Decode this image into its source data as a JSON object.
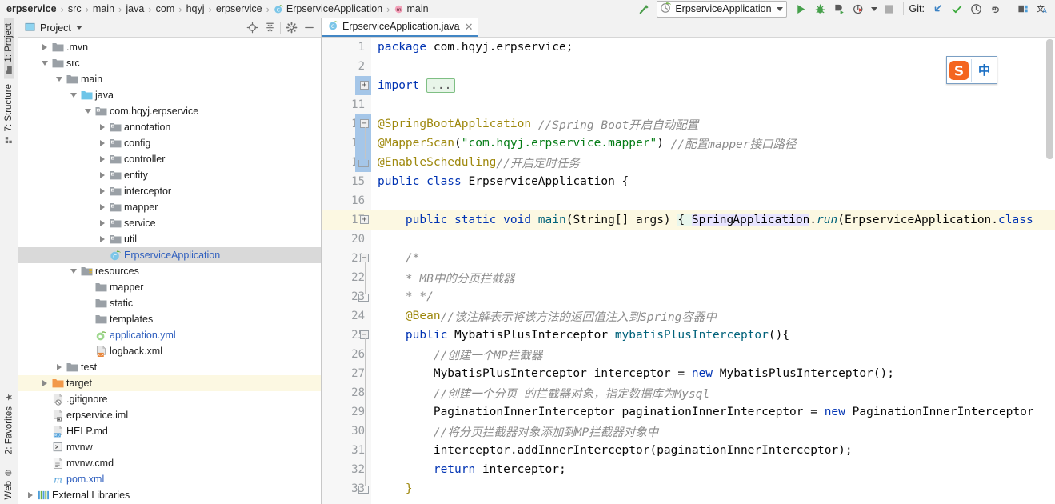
{
  "breadcrumb": {
    "items": [
      {
        "label": "erpservice",
        "icon": "",
        "bold": true
      },
      {
        "label": "src",
        "icon": "",
        "bold": false
      },
      {
        "label": "main",
        "icon": "",
        "bold": false
      },
      {
        "label": "java",
        "icon": "",
        "bold": false
      },
      {
        "label": "com",
        "icon": "",
        "bold": false
      },
      {
        "label": "hqyj",
        "icon": "",
        "bold": false
      },
      {
        "label": "erpservice",
        "icon": "",
        "bold": false
      },
      {
        "label": "ErpserviceApplication",
        "icon": "java-class-icon",
        "bold": false
      },
      {
        "label": "main",
        "icon": "method-icon",
        "bold": false
      }
    ],
    "separator": "›"
  },
  "toolbar": {
    "build_icon": "hammer-icon",
    "run_config": {
      "name": "ErpserviceApplication",
      "icon": "spring-boot-icon",
      "dropdown_icon": "chevron-down-icon"
    },
    "run_icon": "run-icon",
    "debug_icon": "debug-icon",
    "run_coverage_icon": "run-with-coverage-icon",
    "profile_icon": "profiler-icon",
    "profile_dropdown_icon": "chevron-down-icon",
    "stop_icon": "stop-icon",
    "git_label": "Git:",
    "git_update_icon": "update-project-icon",
    "git_commit_icon": "commit-icon",
    "git_history_icon": "history-icon",
    "git_rollback_icon": "rollback-icon",
    "search_everywhere_icon": "search-everywhere-icon",
    "translate_icon": "translate-icon",
    "colors": {
      "run_green": "#46a04b",
      "git_blue": "#3b82c4",
      "check_green": "#3eaa3e"
    }
  },
  "left_rail": {
    "top": [
      {
        "label": "1: Project",
        "icon": "project-icon",
        "active": true
      },
      {
        "label": "7: Structure",
        "icon": "structure-icon",
        "active": false
      }
    ],
    "bottom": [
      {
        "label": "2: Favorites",
        "icon": "star-icon",
        "active": false
      },
      {
        "label": "Web",
        "icon": "web-icon",
        "active": false
      }
    ]
  },
  "project_panel": {
    "title": "Project",
    "title_icon": "project-view-icon",
    "dropdown_icon": "chevron-down-icon",
    "actions": [
      {
        "name": "locate-icon",
        "label": ""
      },
      {
        "name": "collapse-all-icon",
        "label": ""
      },
      {
        "name": "settings-gear-icon",
        "label": ""
      },
      {
        "name": "hide-icon",
        "label": ""
      }
    ],
    "tree": [
      {
        "label": ".mvn",
        "indent": 1,
        "twisty": "right",
        "icon": "folder-icon",
        "state": "normal"
      },
      {
        "label": "src",
        "indent": 1,
        "twisty": "down",
        "icon": "folder-icon",
        "state": "normal"
      },
      {
        "label": "main",
        "indent": 2,
        "twisty": "down",
        "icon": "folder-icon",
        "state": "normal"
      },
      {
        "label": "java",
        "indent": 3,
        "twisty": "down",
        "icon": "source-folder-icon",
        "state": "normal"
      },
      {
        "label": "com.hqyj.erpservice",
        "indent": 4,
        "twisty": "down",
        "icon": "package-icon",
        "state": "normal"
      },
      {
        "label": "annotation",
        "indent": 5,
        "twisty": "right",
        "icon": "package-icon",
        "state": "normal"
      },
      {
        "label": "config",
        "indent": 5,
        "twisty": "right",
        "icon": "package-icon",
        "state": "normal"
      },
      {
        "label": "controller",
        "indent": 5,
        "twisty": "right",
        "icon": "package-icon",
        "state": "normal"
      },
      {
        "label": "entity",
        "indent": 5,
        "twisty": "right",
        "icon": "package-icon",
        "state": "normal"
      },
      {
        "label": "interceptor",
        "indent": 5,
        "twisty": "right",
        "icon": "package-icon",
        "state": "normal"
      },
      {
        "label": "mapper",
        "indent": 5,
        "twisty": "right",
        "icon": "package-icon",
        "state": "normal"
      },
      {
        "label": "service",
        "indent": 5,
        "twisty": "right",
        "icon": "package-icon",
        "state": "normal"
      },
      {
        "label": "util",
        "indent": 5,
        "twisty": "right",
        "icon": "package-icon",
        "state": "normal"
      },
      {
        "label": "ErpserviceApplication",
        "indent": 5,
        "twisty": "none",
        "icon": "spring-class-icon",
        "state": "selected"
      },
      {
        "label": "resources",
        "indent": 3,
        "twisty": "down",
        "icon": "resource-folder-icon",
        "state": "normal"
      },
      {
        "label": "mapper",
        "indent": 4,
        "twisty": "none",
        "icon": "folder-icon",
        "state": "normal"
      },
      {
        "label": "static",
        "indent": 4,
        "twisty": "none",
        "icon": "folder-icon",
        "state": "normal"
      },
      {
        "label": "templates",
        "indent": 4,
        "twisty": "none",
        "icon": "folder-icon",
        "state": "normal"
      },
      {
        "label": "application.yml",
        "indent": 4,
        "twisty": "none",
        "icon": "yml-spring-icon",
        "state": "file"
      },
      {
        "label": "logback.xml",
        "indent": 4,
        "twisty": "none",
        "icon": "xml-file-icon",
        "state": "normal"
      },
      {
        "label": "test",
        "indent": 2,
        "twisty": "right",
        "icon": "folder-icon",
        "state": "normal"
      },
      {
        "label": "target",
        "indent": 1,
        "twisty": "right",
        "icon": "target-folder-icon",
        "state": "highlighted"
      },
      {
        "label": ".gitignore",
        "indent": 1,
        "twisty": "none",
        "icon": "gitignore-file-icon",
        "state": "normal"
      },
      {
        "label": "erpservice.iml",
        "indent": 1,
        "twisty": "none",
        "icon": "iml-file-icon",
        "state": "normal"
      },
      {
        "label": "HELP.md",
        "indent": 1,
        "twisty": "none",
        "icon": "markdown-file-icon",
        "state": "normal"
      },
      {
        "label": "mvnw",
        "indent": 1,
        "twisty": "none",
        "icon": "shell-file-icon",
        "state": "normal"
      },
      {
        "label": "mvnw.cmd",
        "indent": 1,
        "twisty": "none",
        "icon": "text-file-icon",
        "state": "normal"
      },
      {
        "label": "pom.xml",
        "indent": 1,
        "twisty": "none",
        "icon": "maven-file-icon",
        "state": "file"
      },
      {
        "label": "External Libraries",
        "indent": 0,
        "twisty": "right",
        "icon": "libraries-icon",
        "state": "normal"
      }
    ]
  },
  "editor": {
    "tab": {
      "label": "ErpserviceApplication.java",
      "icon": "spring-class-icon",
      "close_icon": "close-icon"
    },
    "line_numbers": [
      1,
      2,
      3,
      11,
      12,
      13,
      14,
      15,
      16,
      17,
      20,
      21,
      22,
      23,
      24,
      25,
      26,
      27,
      28,
      29,
      30,
      31,
      32,
      33
    ],
    "caret_line": 17,
    "run_marker_line": 15,
    "lines": [
      {
        "n": 1,
        "tokens": [
          {
            "t": "package ",
            "c": "kw"
          },
          {
            "t": "com.hqyj.erpservice;",
            "c": "plain"
          }
        ]
      },
      {
        "n": 2,
        "tokens": []
      },
      {
        "n": 3,
        "tokens": [
          {
            "t": "import ",
            "c": "kw"
          },
          {
            "t": "...",
            "c": "fold-ph"
          }
        ]
      },
      {
        "n": 11,
        "tokens": []
      },
      {
        "n": 12,
        "tokens": [
          {
            "t": "@SpringBootApplication",
            "c": "ann"
          },
          {
            "t": " ",
            "c": "plain"
          },
          {
            "t": "//Spring Boot开启自动配置",
            "c": "cmt"
          }
        ]
      },
      {
        "n": 13,
        "tokens": [
          {
            "t": "@MapperScan",
            "c": "ann"
          },
          {
            "t": "(",
            "c": "plain"
          },
          {
            "t": "\"com.hqyj.erpservice.mapper\"",
            "c": "str"
          },
          {
            "t": ") ",
            "c": "plain"
          },
          {
            "t": "//配置mapper接口路径",
            "c": "cmt"
          }
        ]
      },
      {
        "n": 14,
        "tokens": [
          {
            "t": "@EnableScheduling",
            "c": "ann"
          },
          {
            "t": "//开启定时任务",
            "c": "cmt"
          }
        ]
      },
      {
        "n": 15,
        "tokens": [
          {
            "t": "public class ",
            "c": "kw"
          },
          {
            "t": "ErpserviceApplication {",
            "c": "plain"
          }
        ]
      },
      {
        "n": 16,
        "tokens": []
      },
      {
        "n": 17,
        "tokens": [
          {
            "t": "    ",
            "c": "plain"
          },
          {
            "t": "public static void ",
            "c": "kw"
          },
          {
            "t": "main",
            "c": "meth"
          },
          {
            "t": "(String[] args) ",
            "c": "plain"
          },
          {
            "t": "{ ",
            "c": "fold-hl"
          },
          {
            "t": "Spring",
            "c": "sel-bg"
          },
          {
            "t": "|CARET|",
            "c": "caret"
          },
          {
            "t": "Application",
            "c": "sel-bg"
          },
          {
            "t": ".",
            "c": "plain"
          },
          {
            "t": "run",
            "c": "methi"
          },
          {
            "t": "(ErpserviceApplication.",
            "c": "plain"
          },
          {
            "t": "class",
            "c": "kw"
          }
        ]
      },
      {
        "n": 20,
        "tokens": []
      },
      {
        "n": 21,
        "tokens": [
          {
            "t": "    ",
            "c": "plain"
          },
          {
            "t": "/*",
            "c": "cmt"
          }
        ]
      },
      {
        "n": 22,
        "tokens": [
          {
            "t": "    ",
            "c": "plain"
          },
          {
            "t": "* MB中的分页拦截器",
            "c": "cmt"
          }
        ]
      },
      {
        "n": 23,
        "tokens": [
          {
            "t": "    ",
            "c": "plain"
          },
          {
            "t": "* */",
            "c": "cmt"
          }
        ]
      },
      {
        "n": 24,
        "tokens": [
          {
            "t": "    ",
            "c": "plain"
          },
          {
            "t": "@Bean",
            "c": "ann"
          },
          {
            "t": "//该注解表示将该方法的返回值注入到Spring容器中",
            "c": "cmt"
          }
        ]
      },
      {
        "n": 25,
        "tokens": [
          {
            "t": "    ",
            "c": "plain"
          },
          {
            "t": "public ",
            "c": "kw"
          },
          {
            "t": "MybatisPlusInterceptor ",
            "c": "plain"
          },
          {
            "t": "mybatisPlusInterceptor",
            "c": "meth"
          },
          {
            "t": "(){",
            "c": "plain"
          }
        ]
      },
      {
        "n": 26,
        "tokens": [
          {
            "t": "        ",
            "c": "plain"
          },
          {
            "t": "//创建一个MP拦截器",
            "c": "cmt"
          }
        ]
      },
      {
        "n": 27,
        "tokens": [
          {
            "t": "        MybatisPlusInterceptor interceptor = ",
            "c": "plain"
          },
          {
            "t": "new ",
            "c": "kw"
          },
          {
            "t": "MybatisPlusInterceptor();",
            "c": "plain"
          }
        ]
      },
      {
        "n": 28,
        "tokens": [
          {
            "t": "        ",
            "c": "plain"
          },
          {
            "t": "//创建一个分页 的拦截器对象，指定数据库为Mysql",
            "c": "cmt"
          }
        ]
      },
      {
        "n": 29,
        "tokens": [
          {
            "t": "        PaginationInnerInterceptor paginationInnerInterceptor = ",
            "c": "plain"
          },
          {
            "t": "new ",
            "c": "kw"
          },
          {
            "t": "PaginationInnerInterceptor",
            "c": "plain"
          }
        ]
      },
      {
        "n": 30,
        "tokens": [
          {
            "t": "        ",
            "c": "plain"
          },
          {
            "t": "//将分页拦截器对象添加到MP拦截器对象中",
            "c": "cmt"
          }
        ]
      },
      {
        "n": 31,
        "tokens": [
          {
            "t": "        interceptor.addInnerInterceptor(paginationInnerInterceptor);",
            "c": "plain"
          }
        ]
      },
      {
        "n": 32,
        "tokens": [
          {
            "t": "        ",
            "c": "plain"
          },
          {
            "t": "return ",
            "c": "kw"
          },
          {
            "t": "interceptor;",
            "c": "plain"
          }
        ]
      },
      {
        "n": 33,
        "tokens": [
          {
            "t": "    ",
            "c": "plain"
          },
          {
            "t": "}",
            "c": "ann"
          }
        ]
      }
    ]
  },
  "sogou_ime": {
    "logo": "S",
    "mode": "中",
    "logo_color": "#f4651f",
    "mode_color": "#1a6fc4"
  }
}
